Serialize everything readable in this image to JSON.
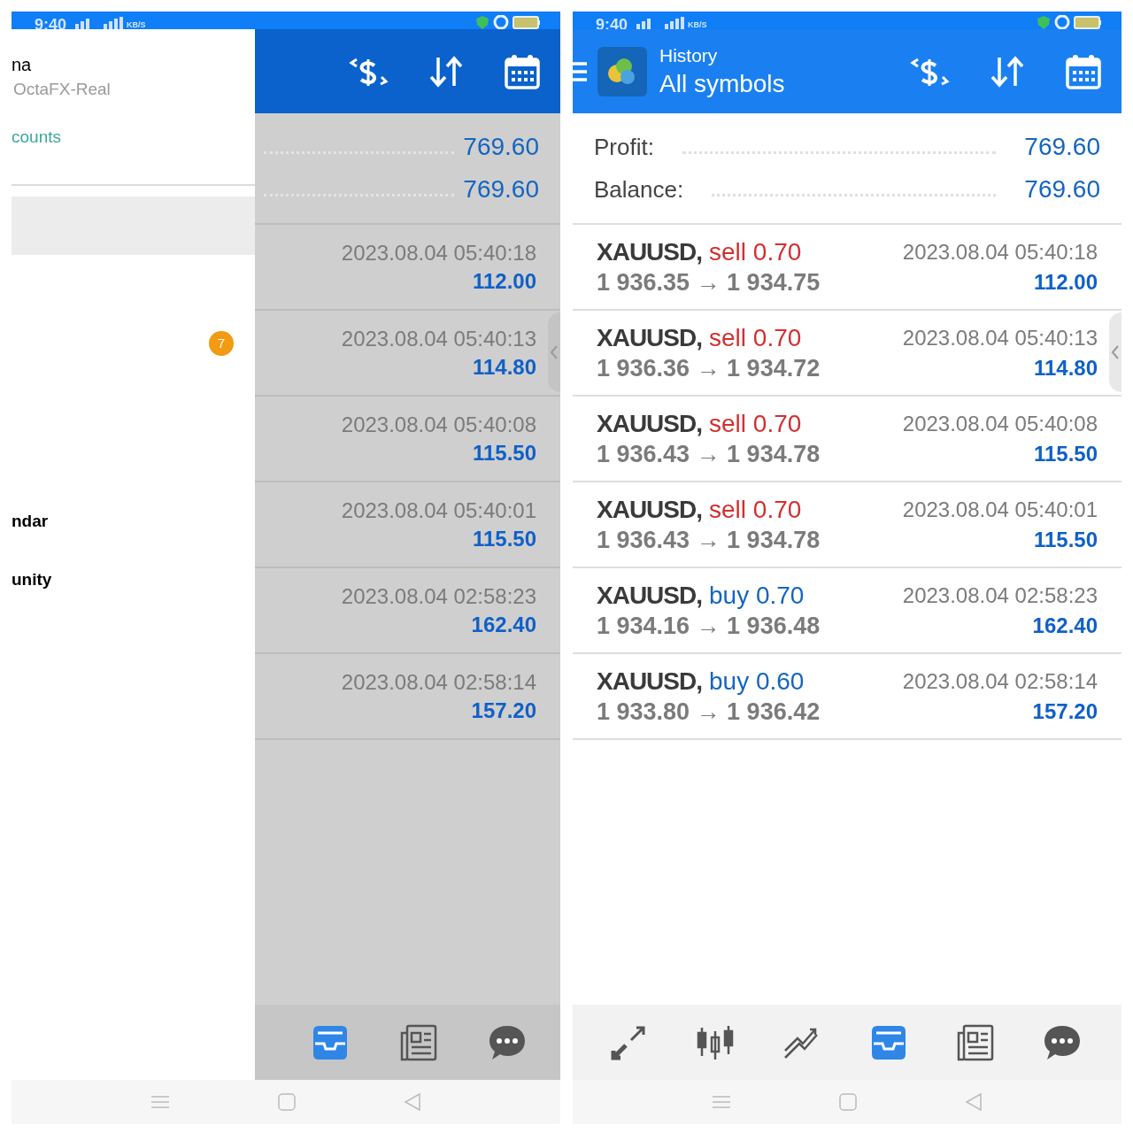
{
  "screens": [
    {
      "status_bar": {
        "time": "9:40",
        "speed_unit": "KB/S"
      },
      "drawer": {
        "name": "na",
        "server": "OctaFX-Real",
        "accounts_link": "counts",
        "badge": "7",
        "items": [
          "ndar",
          "unity"
        ]
      },
      "summary": [
        {
          "value": "769.60"
        },
        {
          "value": "769.60"
        }
      ],
      "trades": [
        {
          "time": "2023.08.04 05:40:18",
          "profit": "112.00"
        },
        {
          "time": "2023.08.04 05:40:13",
          "profit": "114.80"
        },
        {
          "time": "2023.08.04 05:40:08",
          "profit": "115.50"
        },
        {
          "time": "2023.08.04 05:40:01",
          "profit": "115.50"
        },
        {
          "time": "2023.08.04 02:58:23",
          "profit": "162.40"
        },
        {
          "time": "2023.08.04 02:58:14",
          "profit": "157.20"
        }
      ],
      "bottom_nav": [
        {
          "kind": "history",
          "selected": true
        },
        {
          "kind": "news",
          "selected": false
        },
        {
          "kind": "chat",
          "selected": false
        }
      ]
    },
    {
      "status_bar": {
        "time": "9:40",
        "speed_unit": "KB/S"
      },
      "header": {
        "title": "History",
        "subtitle": "All symbols"
      },
      "summary": [
        {
          "label": "Profit:",
          "value": "769.60"
        },
        {
          "label": "Balance:",
          "value": "769.60"
        }
      ],
      "trades": [
        {
          "symbol": "XAUUSD,",
          "order": "sell 0.70",
          "color": "#d32f2f",
          "prices": "1 936.35 → 1 934.75",
          "time": "2023.08.04 05:40:18",
          "profit": "112.00"
        },
        {
          "symbol": "XAUUSD,",
          "order": "sell 0.70",
          "color": "#d32f2f",
          "prices": "1 936.36 → 1 934.72",
          "time": "2023.08.04 05:40:13",
          "profit": "114.80"
        },
        {
          "symbol": "XAUUSD,",
          "order": "sell 0.70",
          "color": "#d32f2f",
          "prices": "1 936.43 → 1 934.78",
          "time": "2023.08.04 05:40:08",
          "profit": "115.50"
        },
        {
          "symbol": "XAUUSD,",
          "order": "sell 0.70",
          "color": "#d32f2f",
          "prices": "1 936.43 → 1 934.78",
          "time": "2023.08.04 05:40:01",
          "profit": "115.50"
        },
        {
          "symbol": "XAUUSD,",
          "order": "buy 0.70",
          "color": "#1565c0",
          "prices": "1 934.16 → 1 936.48",
          "time": "2023.08.04 02:58:23",
          "profit": "162.40"
        },
        {
          "symbol": "XAUUSD,",
          "order": "buy 0.60",
          "color": "#1565c0",
          "prices": "1 933.80 → 1 936.42",
          "time": "2023.08.04 02:58:14",
          "profit": "157.20"
        }
      ],
      "bottom_nav": [
        {
          "kind": "trade",
          "selected": false
        },
        {
          "kind": "quotes",
          "selected": false
        },
        {
          "kind": "chart",
          "selected": false
        },
        {
          "kind": "history",
          "selected": true
        },
        {
          "kind": "news",
          "selected": false
        },
        {
          "kind": "chat",
          "selected": false
        }
      ]
    }
  ]
}
